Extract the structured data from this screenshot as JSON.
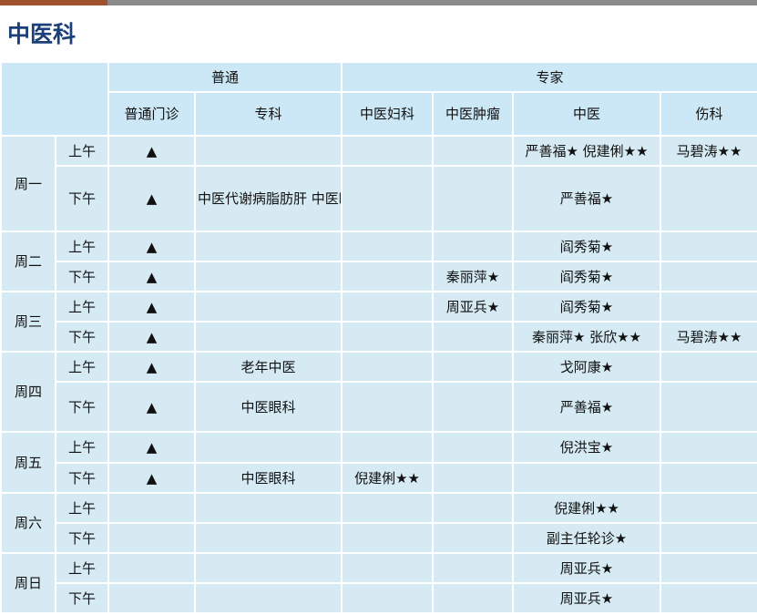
{
  "page": {
    "title": "中医科"
  },
  "headers": {
    "group_general": "普通",
    "group_expert": "专家",
    "columns": [
      "普通门诊",
      "专科",
      "中医妇科",
      "中医肿瘤",
      "中医",
      "伤科"
    ]
  },
  "schedule": [
    {
      "day": "周一",
      "am": {
        "period": "上午",
        "general": "▲",
        "specialty": "",
        "gyn": "",
        "onc": "",
        "tcm": "严善福★  倪建俐★★",
        "ortho": "马碧涛★★"
      },
      "pm": {
        "period": "下午",
        "general": "▲",
        "specialty": "中医代谢病脂肪肝 中医眼科",
        "gyn": "",
        "onc": "",
        "tcm": "严善福★",
        "ortho": ""
      }
    },
    {
      "day": "周二",
      "am": {
        "period": "上午",
        "general": "▲",
        "specialty": "",
        "gyn": "",
        "onc": "",
        "tcm": "阎秀菊★",
        "ortho": ""
      },
      "pm": {
        "period": "下午",
        "general": "▲",
        "specialty": "",
        "gyn": "",
        "onc": "秦丽萍★",
        "tcm": "阎秀菊★",
        "ortho": ""
      }
    },
    {
      "day": "周三",
      "am": {
        "period": "上午",
        "general": "▲",
        "specialty": "",
        "gyn": "",
        "onc": "周亚兵★",
        "tcm": "阎秀菊★",
        "ortho": ""
      },
      "pm": {
        "period": "下午",
        "general": "▲",
        "specialty": "",
        "gyn": "",
        "onc": "",
        "tcm": "秦丽萍★  张欣★★",
        "ortho": "马碧涛★★"
      }
    },
    {
      "day": "周四",
      "am": {
        "period": "上午",
        "general": "▲",
        "specialty": "老年中医",
        "gyn": "",
        "onc": "",
        "tcm": "戈阿康★",
        "ortho": ""
      },
      "pm": {
        "period": "下午",
        "general": "▲",
        "specialty": "中医眼科",
        "gyn": "",
        "onc": "",
        "tcm": "严善福★",
        "ortho": ""
      }
    },
    {
      "day": "周五",
      "am": {
        "period": "上午",
        "general": "▲",
        "specialty": "",
        "gyn": "",
        "onc": "",
        "tcm": "倪洪宝★",
        "ortho": ""
      },
      "pm": {
        "period": "下午",
        "general": "▲",
        "specialty": "中医眼科",
        "gyn": "倪建俐★★",
        "onc": "",
        "tcm": "",
        "ortho": ""
      }
    },
    {
      "day": "周六",
      "am": {
        "period": "上午",
        "general": "",
        "specialty": "",
        "gyn": "",
        "onc": "",
        "tcm": "倪建俐★★",
        "ortho": ""
      },
      "pm": {
        "period": "下午",
        "general": "",
        "specialty": "",
        "gyn": "",
        "onc": "",
        "tcm": "副主任轮诊★",
        "ortho": ""
      }
    },
    {
      "day": "周日",
      "am": {
        "period": "上午",
        "general": "",
        "specialty": "",
        "gyn": "",
        "onc": "",
        "tcm": "周亚兵★",
        "ortho": ""
      },
      "pm": {
        "period": "下午",
        "general": "",
        "specialty": "",
        "gyn": "",
        "onc": "",
        "tcm": "周亚兵★",
        "ortho": ""
      }
    }
  ],
  "colors": {
    "title": "#1b3f78",
    "header_bg": "#cce8f6",
    "cell_bg": "#d6eaf4",
    "accent": "#a0522d"
  }
}
